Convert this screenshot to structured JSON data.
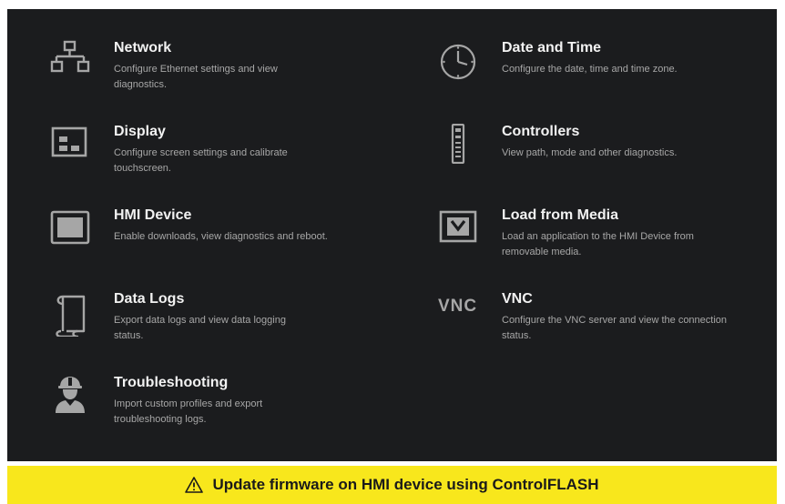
{
  "tiles": {
    "network": {
      "title": "Network",
      "desc": "Configure Ethernet settings and view diagnostics.",
      "icon": "network-icon"
    },
    "date_time": {
      "title": "Date and Time",
      "desc": "Configure the date, time and time zone.",
      "icon": "clock-icon"
    },
    "display": {
      "title": "Display",
      "desc": "Configure screen settings and calibrate touchscreen.",
      "icon": "display-icon"
    },
    "controllers": {
      "title": "Controllers",
      "desc": "View path, mode and other diagnostics.",
      "icon": "controller-icon"
    },
    "hmi_device": {
      "title": "HMI Device",
      "desc": "Enable downloads, view diagnostics and reboot.",
      "icon": "hmi-device-icon"
    },
    "load_media": {
      "title": "Load from Media",
      "desc": "Load an application to the HMI Device from removable media.",
      "icon": "download-icon"
    },
    "data_logs": {
      "title": "Data Logs",
      "desc": "Export data logs and view data logging status.",
      "icon": "scroll-icon"
    },
    "vnc": {
      "title": "VNC",
      "logo": "VNC",
      "desc": "Configure the VNC server and view the connection status.",
      "icon": "vnc-icon"
    },
    "troubleshooting": {
      "title": "Troubleshooting",
      "desc": "Import custom profiles and export troubleshooting logs.",
      "icon": "technician-icon"
    }
  },
  "banner": {
    "text": "Update firmware on HMI device using ControlFLASH",
    "icon": "warning-icon"
  },
  "colors": {
    "background": "#1b1c1e",
    "title": "#f2f2f2",
    "description": "#a7a7a7",
    "icon": "#a6a6a6",
    "banner": "#f8e71c"
  }
}
